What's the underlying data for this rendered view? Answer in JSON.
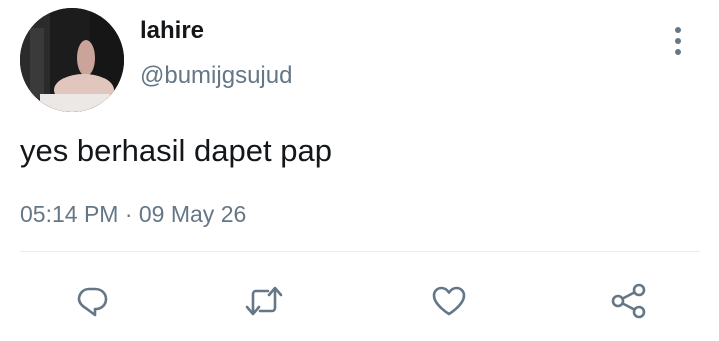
{
  "user": {
    "display_name": "lahire",
    "handle": "@bumijgsujud"
  },
  "tweet": {
    "text": "yes berhasil dapet pap",
    "timestamp": "05:14 PM · 09 May 26"
  },
  "icons": {
    "more": "more-vertical-icon",
    "reply": "reply-icon",
    "retweet": "retweet-icon",
    "like": "heart-icon",
    "share": "share-icon"
  },
  "colors": {
    "text": "#14171a",
    "secondary": "#657786",
    "divider": "#e6ecf0",
    "icon": "#657786"
  }
}
